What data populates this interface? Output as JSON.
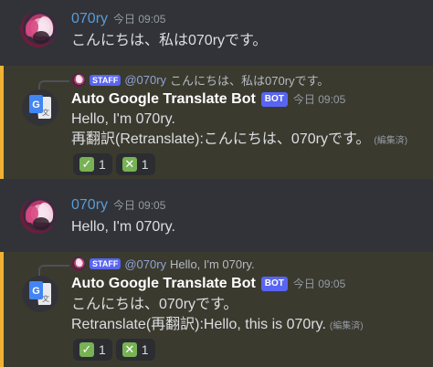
{
  "colors": {
    "accent_name": "#5a9bd5",
    "highlight_border": "#f0b232",
    "bot_tag": "#5865f2",
    "reaction_green": "#77b255"
  },
  "messages": [
    {
      "author": "070ry",
      "timestamp": "今日 09:05",
      "text": "こんにちは、私は070ryです。"
    },
    {
      "reply": {
        "badge": "STAFF",
        "mention": "@070ry",
        "text": "こんにちは、私は070ryです。"
      },
      "author": "Auto Google Translate Bot",
      "bot_tag": "BOT",
      "timestamp": "今日 09:05",
      "line1": "Hello, I'm 070ry.",
      "line2": "再翻訳(Retranslate):こんにちは、070ryです。",
      "edited": "(編集済)",
      "reactions": [
        {
          "icon": "check-mark-icon",
          "glyph": "✓",
          "count": "1"
        },
        {
          "icon": "cross-mark-icon",
          "glyph": "✕",
          "count": "1"
        }
      ]
    },
    {
      "author": "070ry",
      "timestamp": "今日 09:05",
      "text": "Hello, I'm 070ry."
    },
    {
      "reply": {
        "badge": "STAFF",
        "mention": "@070ry",
        "text": "Hello, I'm 070ry."
      },
      "author": "Auto Google Translate Bot",
      "bot_tag": "BOT",
      "timestamp": "今日 09:05",
      "line1": "こんにちは、070ryです。",
      "line2": "Retranslate(再翻訳):Hello, this is 070ry.",
      "edited": "(編集済)",
      "reactions": [
        {
          "icon": "check-mark-icon",
          "glyph": "✓",
          "count": "1"
        },
        {
          "icon": "cross-mark-icon",
          "glyph": "✕",
          "count": "1"
        }
      ]
    }
  ]
}
